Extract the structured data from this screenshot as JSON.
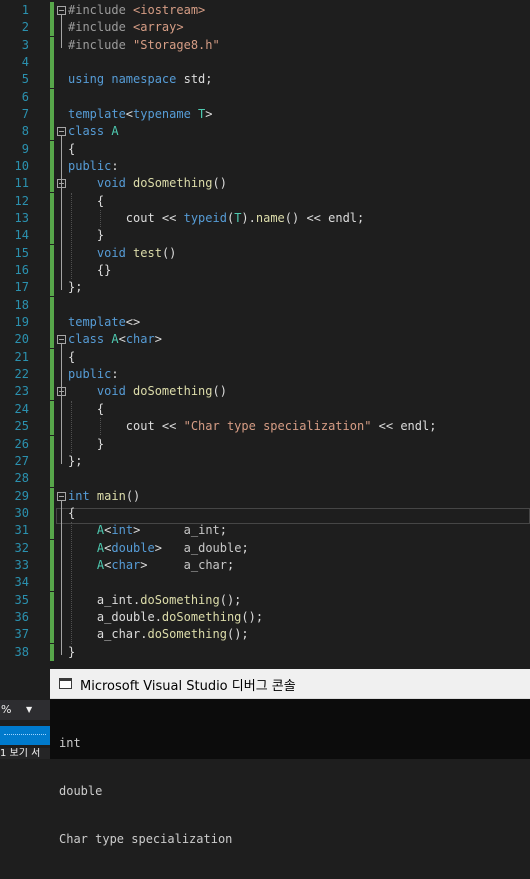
{
  "editor": {
    "lines": [
      {
        "n": "1",
        "tokens": [
          {
            "t": "#include ",
            "c": "pp"
          },
          {
            "t": "<iostream>",
            "c": "str"
          }
        ]
      },
      {
        "n": "2",
        "tokens": [
          {
            "t": "#include ",
            "c": "pp"
          },
          {
            "t": "<array>",
            "c": "str"
          }
        ]
      },
      {
        "n": "3",
        "tokens": [
          {
            "t": "#include ",
            "c": "pp"
          },
          {
            "t": "\"Storage8.h\"",
            "c": "str"
          }
        ]
      },
      {
        "n": "4",
        "tokens": []
      },
      {
        "n": "5",
        "tokens": [
          {
            "t": "using namespace ",
            "c": "kw"
          },
          {
            "t": "std;",
            "c": "pl"
          }
        ]
      },
      {
        "n": "6",
        "tokens": []
      },
      {
        "n": "7",
        "tokens": [
          {
            "t": "template",
            "c": "kw"
          },
          {
            "t": "<",
            "c": "pl"
          },
          {
            "t": "typename",
            "c": "kw"
          },
          {
            "t": " T",
            "c": "ty"
          },
          {
            "t": ">",
            "c": "pl"
          }
        ]
      },
      {
        "n": "8",
        "tokens": [
          {
            "t": "class ",
            "c": "kw"
          },
          {
            "t": "A",
            "c": "ty"
          }
        ]
      },
      {
        "n": "9",
        "tokens": [
          {
            "t": "{",
            "c": "pl"
          }
        ]
      },
      {
        "n": "10",
        "tokens": [
          {
            "t": "public",
            "c": "kw"
          },
          {
            "t": ":",
            "c": "pl"
          }
        ]
      },
      {
        "n": "11",
        "tokens": [
          {
            "t": "    ",
            "c": "pl"
          },
          {
            "t": "void ",
            "c": "kw"
          },
          {
            "t": "doSomething",
            "c": "fn"
          },
          {
            "t": "()",
            "c": "pl"
          }
        ]
      },
      {
        "n": "12",
        "tokens": [
          {
            "t": "    {",
            "c": "pl"
          }
        ]
      },
      {
        "n": "13",
        "tokens": [
          {
            "t": "        cout << ",
            "c": "pl"
          },
          {
            "t": "typeid",
            "c": "kw"
          },
          {
            "t": "(",
            "c": "pl"
          },
          {
            "t": "T",
            "c": "ty"
          },
          {
            "t": ").",
            "c": "pl"
          },
          {
            "t": "name",
            "c": "fn"
          },
          {
            "t": "() << endl;",
            "c": "pl"
          }
        ]
      },
      {
        "n": "14",
        "tokens": [
          {
            "t": "    }",
            "c": "pl"
          }
        ]
      },
      {
        "n": "15",
        "tokens": [
          {
            "t": "    ",
            "c": "pl"
          },
          {
            "t": "void ",
            "c": "kw"
          },
          {
            "t": "test",
            "c": "fn"
          },
          {
            "t": "()",
            "c": "pl"
          }
        ]
      },
      {
        "n": "16",
        "tokens": [
          {
            "t": "    {}",
            "c": "pl"
          }
        ]
      },
      {
        "n": "17",
        "tokens": [
          {
            "t": "};",
            "c": "pl"
          }
        ]
      },
      {
        "n": "18",
        "tokens": []
      },
      {
        "n": "19",
        "tokens": [
          {
            "t": "template",
            "c": "kw"
          },
          {
            "t": "<>",
            "c": "pl"
          }
        ]
      },
      {
        "n": "20",
        "tokens": [
          {
            "t": "class ",
            "c": "kw"
          },
          {
            "t": "A",
            "c": "ty"
          },
          {
            "t": "<",
            "c": "pl"
          },
          {
            "t": "char",
            "c": "kw"
          },
          {
            "t": ">",
            "c": "pl"
          }
        ]
      },
      {
        "n": "21",
        "tokens": [
          {
            "t": "{",
            "c": "pl"
          }
        ]
      },
      {
        "n": "22",
        "tokens": [
          {
            "t": "public",
            "c": "kw"
          },
          {
            "t": ":",
            "c": "pl"
          }
        ]
      },
      {
        "n": "23",
        "tokens": [
          {
            "t": "    ",
            "c": "pl"
          },
          {
            "t": "void ",
            "c": "kw"
          },
          {
            "t": "doSomething",
            "c": "fn"
          },
          {
            "t": "()",
            "c": "pl"
          }
        ]
      },
      {
        "n": "24",
        "tokens": [
          {
            "t": "    {",
            "c": "pl"
          }
        ]
      },
      {
        "n": "25",
        "tokens": [
          {
            "t": "        cout << ",
            "c": "pl"
          },
          {
            "t": "\"Char type specialization\"",
            "c": "str"
          },
          {
            "t": " << endl;",
            "c": "pl"
          }
        ]
      },
      {
        "n": "26",
        "tokens": [
          {
            "t": "    }",
            "c": "pl"
          }
        ]
      },
      {
        "n": "27",
        "tokens": [
          {
            "t": "};",
            "c": "pl"
          }
        ]
      },
      {
        "n": "28",
        "tokens": []
      },
      {
        "n": "29",
        "tokens": [
          {
            "t": "int ",
            "c": "kw"
          },
          {
            "t": "main",
            "c": "fn"
          },
          {
            "t": "()",
            "c": "pl"
          }
        ]
      },
      {
        "n": "30",
        "tokens": [
          {
            "t": "{",
            "c": "pl"
          }
        ]
      },
      {
        "n": "31",
        "tokens": [
          {
            "t": "    ",
            "c": "pl"
          },
          {
            "t": "A",
            "c": "ty"
          },
          {
            "t": "<",
            "c": "pl"
          },
          {
            "t": "int",
            "c": "kw"
          },
          {
            "t": ">      ",
            "c": "pl"
          },
          {
            "t": "a_int",
            "c": "nm"
          },
          {
            "t": ";",
            "c": "pl"
          }
        ]
      },
      {
        "n": "32",
        "tokens": [
          {
            "t": "    ",
            "c": "pl"
          },
          {
            "t": "A",
            "c": "ty"
          },
          {
            "t": "<",
            "c": "pl"
          },
          {
            "t": "double",
            "c": "kw"
          },
          {
            "t": ">   ",
            "c": "pl"
          },
          {
            "t": "a_double",
            "c": "nm"
          },
          {
            "t": ";",
            "c": "pl"
          }
        ]
      },
      {
        "n": "33",
        "tokens": [
          {
            "t": "    ",
            "c": "pl"
          },
          {
            "t": "A",
            "c": "ty"
          },
          {
            "t": "<",
            "c": "pl"
          },
          {
            "t": "char",
            "c": "kw"
          },
          {
            "t": ">     ",
            "c": "pl"
          },
          {
            "t": "a_char",
            "c": "nm"
          },
          {
            "t": ";",
            "c": "pl"
          }
        ]
      },
      {
        "n": "34",
        "tokens": []
      },
      {
        "n": "35",
        "tokens": [
          {
            "t": "    a_int.",
            "c": "pl"
          },
          {
            "t": "doSomething",
            "c": "fn"
          },
          {
            "t": "();",
            "c": "pl"
          }
        ]
      },
      {
        "n": "36",
        "tokens": [
          {
            "t": "    a_double.",
            "c": "pl"
          },
          {
            "t": "doSomething",
            "c": "fn"
          },
          {
            "t": "();",
            "c": "pl"
          }
        ]
      },
      {
        "n": "37",
        "tokens": [
          {
            "t": "    a_char.",
            "c": "pl"
          },
          {
            "t": "doSomething",
            "c": "fn"
          },
          {
            "t": "();",
            "c": "pl"
          }
        ]
      },
      {
        "n": "38",
        "tokens": [
          {
            "t": "}",
            "c": "pl"
          }
        ]
      }
    ],
    "colors": {
      "keyword": "#569cd6",
      "preprocessor": "#9b9b9b",
      "string": "#d69d85",
      "type": "#4ec9b0",
      "function": "#dcdcaa",
      "line_number": "#2b91af",
      "changed_margin": "#57a64a"
    }
  },
  "console": {
    "title": "Microsoft Visual Studio 디버그 콘솔",
    "output": [
      "int",
      "double",
      "Char type specialization"
    ]
  },
  "statusbar": {
    "zoom_value": "%",
    "fragment_text": "1 보기 서"
  }
}
